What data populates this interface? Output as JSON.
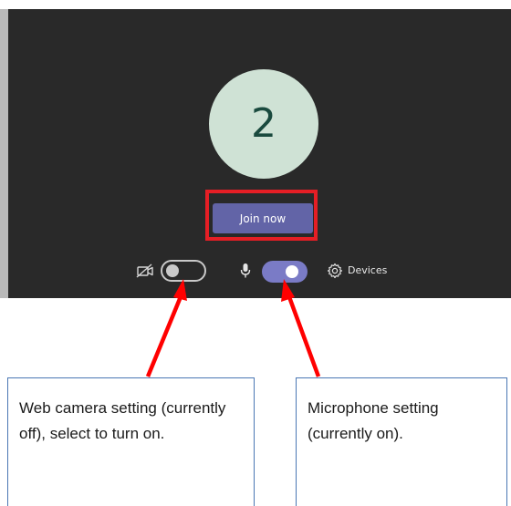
{
  "meeting": {
    "avatar_initial": "2",
    "join_button_label": "Join now",
    "camera_on": false,
    "microphone_on": true,
    "devices_label": "Devices"
  },
  "annotations": {
    "highlight_color": "#e51e25",
    "arrow_color": "#ff0000",
    "callout_border_color": "#4a77b4",
    "camera_callout_text": "Web camera setting (currently off), select to turn on.",
    "microphone_callout_text": "Microphone setting (currently on)."
  },
  "theme": {
    "background": "#292929",
    "avatar_bg": "#cfe2d5",
    "avatar_text": "#1a4a3e",
    "join_button_bg": "#6264a7",
    "toggle_on_bg": "#7a7bc6"
  },
  "icons": {
    "camera": "camera-off-icon",
    "microphone": "microphone-icon",
    "devices": "gear-icon"
  }
}
